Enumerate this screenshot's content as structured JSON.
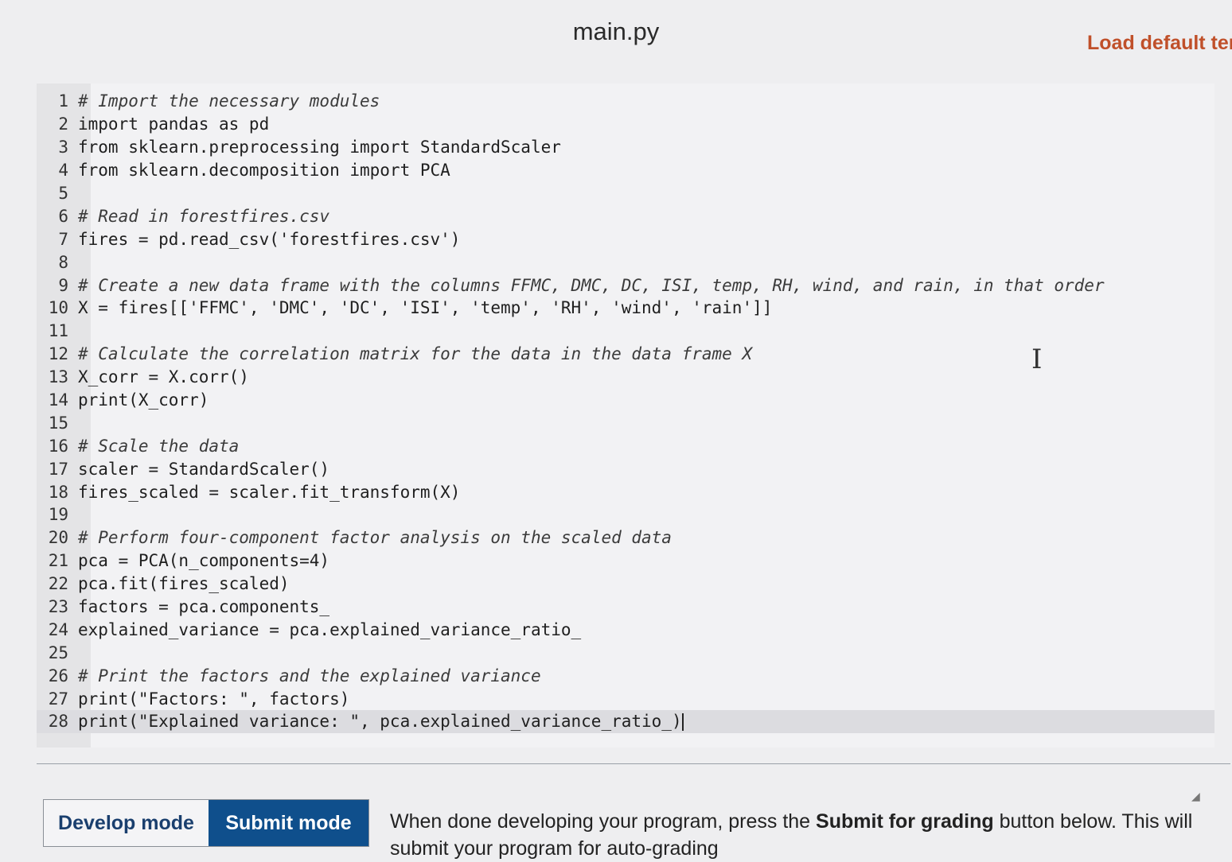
{
  "header": {
    "file_name": "main.py",
    "load_default_label": "Load default ter"
  },
  "editor": {
    "lines": [
      {
        "num": "1",
        "text": "# Import the necessary modules",
        "type": "comment"
      },
      {
        "num": "2",
        "text": "import pandas as pd",
        "type": "code"
      },
      {
        "num": "3",
        "text": "from sklearn.preprocessing import StandardScaler",
        "type": "code"
      },
      {
        "num": "4",
        "text": "from sklearn.decomposition import PCA",
        "type": "code"
      },
      {
        "num": "5",
        "text": "",
        "type": "code"
      },
      {
        "num": "6",
        "text": "# Read in forestfires.csv",
        "type": "comment"
      },
      {
        "num": "7",
        "text": "fires = pd.read_csv('forestfires.csv')",
        "type": "code"
      },
      {
        "num": "8",
        "text": "",
        "type": "code"
      },
      {
        "num": "9",
        "text": "# Create a new data frame with the columns FFMC, DMC, DC, ISI, temp, RH, wind, and rain, in that order",
        "type": "comment"
      },
      {
        "num": "10",
        "text": "X = fires[['FFMC', 'DMC', 'DC', 'ISI', 'temp', 'RH', 'wind', 'rain']]",
        "type": "code"
      },
      {
        "num": "11",
        "text": "",
        "type": "code"
      },
      {
        "num": "12",
        "text": "# Calculate the correlation matrix for the data in the data frame X",
        "type": "comment"
      },
      {
        "num": "13",
        "text": "X_corr = X.corr()",
        "type": "code"
      },
      {
        "num": "14",
        "text": "print(X_corr)",
        "type": "code"
      },
      {
        "num": "15",
        "text": "",
        "type": "code"
      },
      {
        "num": "16",
        "text": "# Scale the data",
        "type": "comment"
      },
      {
        "num": "17",
        "text": "scaler = StandardScaler()",
        "type": "code"
      },
      {
        "num": "18",
        "text": "fires_scaled = scaler.fit_transform(X)",
        "type": "code"
      },
      {
        "num": "19",
        "text": "",
        "type": "code"
      },
      {
        "num": "20",
        "text": "# Perform four-component factor analysis on the scaled data",
        "type": "comment"
      },
      {
        "num": "21",
        "text": "pca = PCA(n_components=4)",
        "type": "code"
      },
      {
        "num": "22",
        "text": "pca.fit(fires_scaled)",
        "type": "code"
      },
      {
        "num": "23",
        "text": "factors = pca.components_",
        "type": "code"
      },
      {
        "num": "24",
        "text": "explained_variance = pca.explained_variance_ratio_",
        "type": "code"
      },
      {
        "num": "25",
        "text": "",
        "type": "code"
      },
      {
        "num": "26",
        "text": "# Print the factors and the explained variance",
        "type": "comment"
      },
      {
        "num": "27",
        "text": "print(\"Factors: \", factors)",
        "type": "code"
      },
      {
        "num": "28",
        "text": "print(\"Explained variance: \", pca.explained_variance_ratio_)",
        "type": "code",
        "active": true
      }
    ]
  },
  "modes": {
    "develop_label": "Develop mode",
    "submit_label": "Submit mode",
    "selected": "Submit mode"
  },
  "instructions": {
    "before": "When done developing your program, press the ",
    "bold": "Submit for grading",
    "after": " button below. This will submit your program for auto-grading"
  },
  "colors": {
    "accent": "#0f4f8c",
    "load_default": "#c0502a"
  }
}
